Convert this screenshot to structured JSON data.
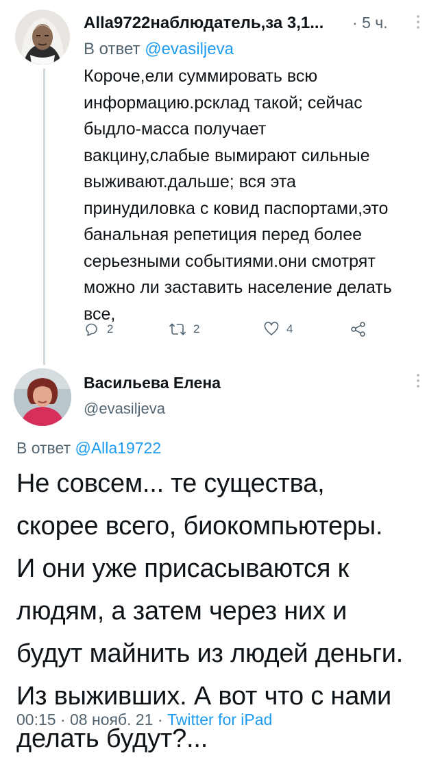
{
  "reply_tweet": {
    "display_name": "Alla9722наблюдатель,за 3,1...",
    "separator": "·",
    "time": "5 ч.",
    "reply_prefix": "В ответ",
    "reply_to": "@evasiljeva",
    "body": "Короче,ели суммировать всю\nинформацию.рсклад такой; сейчас\nбыдло-масса получает\nвакцину,слабые вымирают сильные\nвыживают.дальше; вся эта\nпринудиловка с ковид паспортами,это\nбанальная репетиция перед более\nсерьезными событиями.они смотрят\nможно ли заставить население делать\nвсе,",
    "actions": {
      "reply_icon": "reply-bubble-icon",
      "reply_count": "2",
      "retweet_icon": "retweet-icon",
      "retweet_count": "2",
      "like_icon": "heart-icon",
      "like_count": "4",
      "share_icon": "share-icon"
    }
  },
  "main_tweet": {
    "display_name": "Васильева Елена",
    "handle": "@evasiljeva",
    "reply_prefix": "В ответ",
    "reply_to": "@Alla19722",
    "body": "Не совсем... те существа,\nскорее всего, биокомпьютеры.\nИ они уже присасываются к\nлюдям, а затем через них и\nбудут майнить из людей деньги.\nИз выживших. А вот что с нами\nделать будут?...",
    "time": "00:15",
    "date": "08 нояб. 21",
    "separator": "·",
    "source": "Twitter for iPad"
  },
  "colors": {
    "accent": "#1d9bf0",
    "secondary_text": "#536471",
    "thread_line": "#cfd9de"
  }
}
